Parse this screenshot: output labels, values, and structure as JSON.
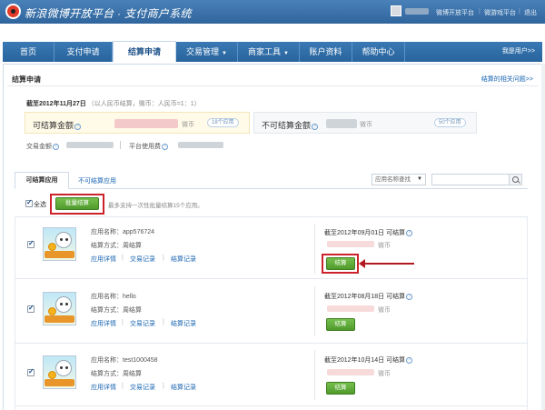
{
  "header": {
    "app_title": "新浪微博开放平台 · 支付商户系统",
    "links": [
      "微博开放平台",
      "微游戏平台",
      "退出"
    ],
    "link_separator": "|"
  },
  "nav": {
    "items": [
      {
        "label": "首页",
        "active": false,
        "dropdown": false
      },
      {
        "label": "支付申请",
        "active": false,
        "dropdown": false
      },
      {
        "label": "结算申请",
        "active": true,
        "dropdown": false
      },
      {
        "label": "交易管理",
        "active": false,
        "dropdown": true
      },
      {
        "label": "商家工具",
        "active": false,
        "dropdown": true
      },
      {
        "label": "账户资料",
        "active": false,
        "dropdown": false
      },
      {
        "label": "帮助中心",
        "active": false,
        "dropdown": false
      }
    ],
    "user_text": "我是用户>>"
  },
  "settlement": {
    "section_title": "结算申请",
    "help_link": "结算的相关问题>>",
    "date_label": "截至2012年11月27日",
    "date_note": "（以人民币结算，微币：人民币=1：1）",
    "settleable_label": "可结算金额",
    "settleable_unit": "微币",
    "settleable_badge": "18个应用",
    "unsettleable_label": "不可结算金额",
    "unsettleable_unit": "微币",
    "unsettleable_badge": "50个应用",
    "trade_amount_label": "交易金额",
    "platform_fee_label": "平台使用费"
  },
  "tabs": {
    "active": "可结算应用",
    "other": "不可结算应用",
    "search_select": "应用名称查找"
  },
  "batch": {
    "select_all": "全选",
    "batch_button": "批量结算",
    "note": "最多支持一次性批量结算15个应用。"
  },
  "apps": [
    {
      "name": "应用名称：app576724",
      "mode": "结算方式：周结算",
      "links": [
        "应用详情",
        "交易记录",
        "结算记录"
      ],
      "settle_date": "截至2012年09月01日 可结算",
      "unit": "微币",
      "button": "结算",
      "checked": true
    },
    {
      "name": "应用名称：hello",
      "mode": "结算方式：周结算",
      "links": [
        "应用详情",
        "交易记录",
        "结算记录"
      ],
      "settle_date": "截至2012年08月18日 可结算",
      "unit": "微币",
      "button": "结算",
      "checked": true
    },
    {
      "name": "应用名称：test1000458",
      "mode": "结算方式：周结算",
      "links": [
        "应用详情",
        "交易记录",
        "结算记录"
      ],
      "settle_date": "截至2012年10月14日 可结算",
      "unit": "微币",
      "button": "结算",
      "checked": true
    }
  ],
  "colors": {
    "nav_blue": "#2f6ba6",
    "accent_green": "#5aa832",
    "highlight_red": "#cc2229",
    "link_blue": "#1a66b3"
  }
}
